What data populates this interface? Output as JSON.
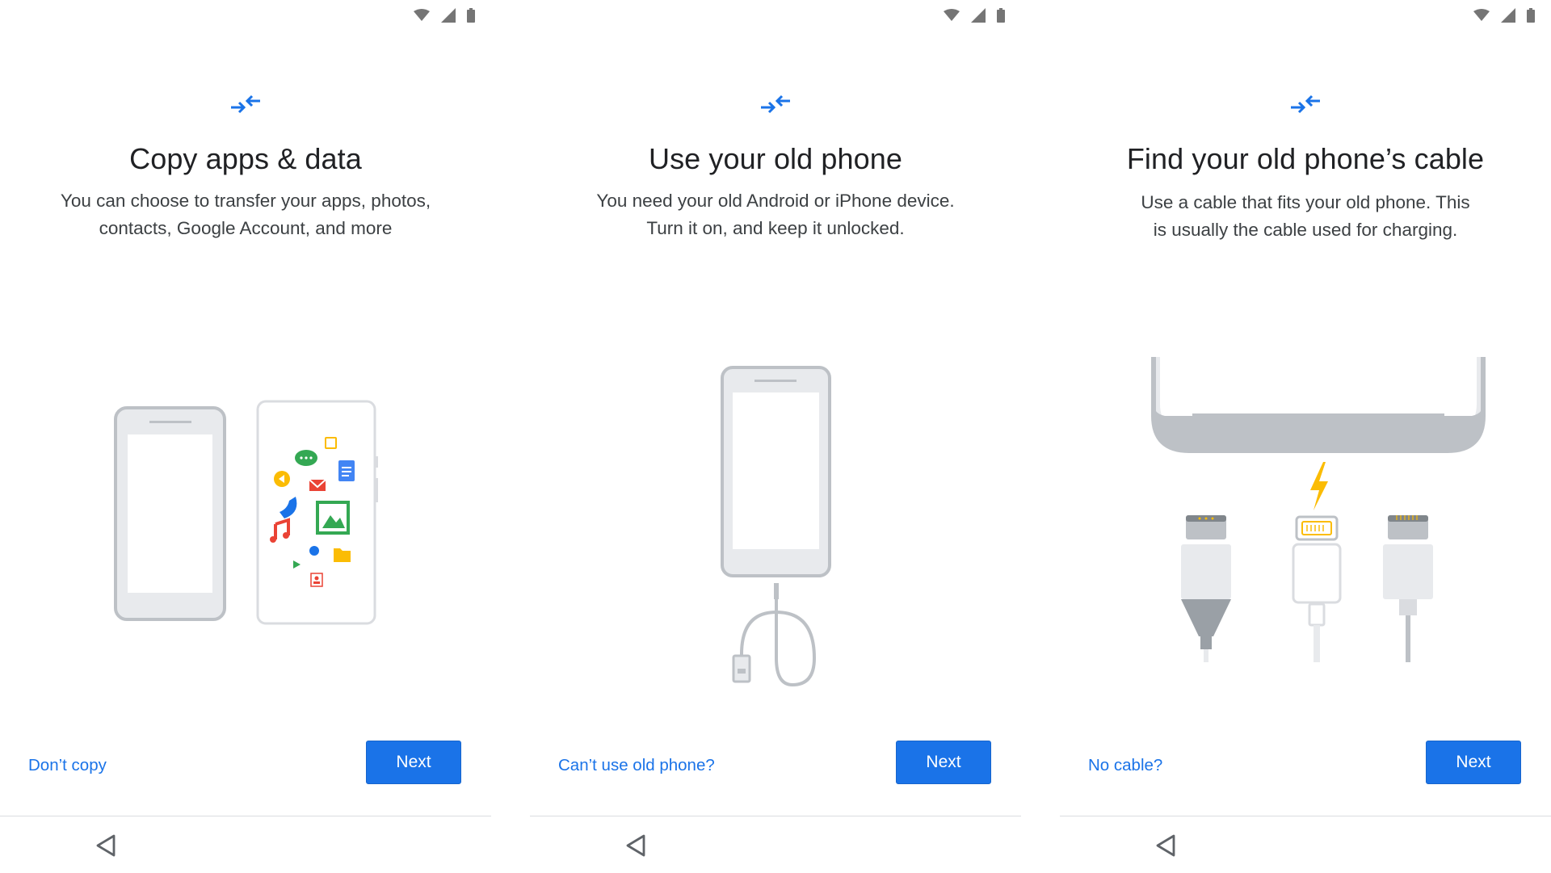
{
  "colors": {
    "accent": "#1a73e8",
    "title": "#202124",
    "body": "#3c4043",
    "illustration_gray": "#bdc1c6"
  },
  "status_icons": [
    "wifi-icon",
    "cellular-signal-icon",
    "battery-icon"
  ],
  "screens": [
    {
      "title": "Copy apps & data",
      "description_lines": [
        "You can choose to transfer your apps, photos,",
        "contacts, Google Account, and more"
      ],
      "secondary_action": "Don’t copy",
      "primary_action": "Next",
      "illustration": "two-phones-with-app-icons"
    },
    {
      "title": "Use your old phone",
      "description_lines": [
        "You need your old Android or iPhone device.",
        "Turn it on, and keep it unlocked."
      ],
      "secondary_action": "Can’t use old phone?",
      "primary_action": "Next",
      "illustration": "phone-with-cable"
    },
    {
      "title": "Find your old phone’s cable",
      "description_lines": [
        "Use a cable that fits your old phone. This",
        "is usually the cable used for charging."
      ],
      "secondary_action": "No cable?",
      "primary_action": "Next",
      "illustration": "phone-port-and-cables"
    }
  ],
  "nav": {
    "back": "back-triangle-icon"
  }
}
